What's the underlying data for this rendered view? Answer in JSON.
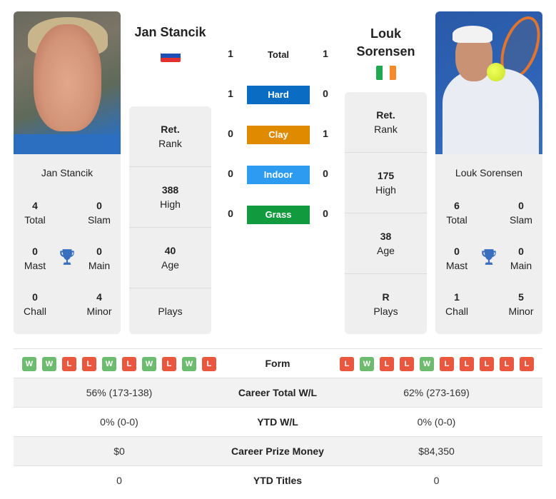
{
  "colors": {
    "hard": "#0a6cc2",
    "clay": "#e08a00",
    "indoor": "#2d9bf0",
    "grass": "#119a3e",
    "win": "#6dbb6f",
    "loss": "#e9573f",
    "trophy": "#3a6fbf"
  },
  "player1": {
    "name": "Jan Stancik",
    "country_flag": "slovakia-flag",
    "card_name": "Jan Stancik",
    "titles": {
      "total": {
        "value": "4",
        "label": "Total"
      },
      "slam": {
        "value": "0",
        "label": "Slam"
      },
      "mast": {
        "value": "0",
        "label": "Mast"
      },
      "main": {
        "value": "0",
        "label": "Main"
      },
      "chall": {
        "value": "0",
        "label": "Chall"
      },
      "minor": {
        "value": "4",
        "label": "Minor"
      }
    },
    "rank": {
      "value": "Ret.",
      "label": "Rank"
    },
    "high": {
      "value": "388",
      "label": "High"
    },
    "age": {
      "value": "40",
      "label": "Age"
    },
    "plays": {
      "value": "",
      "label": "Plays"
    },
    "form": [
      "W",
      "W",
      "L",
      "L",
      "W",
      "L",
      "W",
      "L",
      "W",
      "L"
    ],
    "career_wl": "56% (173-138)",
    "ytd_wl": "0% (0-0)",
    "prize_money": "$0",
    "ytd_titles": "0"
  },
  "player2": {
    "name_line1": "Louk",
    "name_line2": "Sorensen",
    "country_flag": "ireland-flag",
    "card_name": "Louk Sorensen",
    "titles": {
      "total": {
        "value": "6",
        "label": "Total"
      },
      "slam": {
        "value": "0",
        "label": "Slam"
      },
      "mast": {
        "value": "0",
        "label": "Mast"
      },
      "main": {
        "value": "0",
        "label": "Main"
      },
      "chall": {
        "value": "1",
        "label": "Chall"
      },
      "minor": {
        "value": "5",
        "label": "Minor"
      }
    },
    "rank": {
      "value": "Ret.",
      "label": "Rank"
    },
    "high": {
      "value": "175",
      "label": "High"
    },
    "age": {
      "value": "38",
      "label": "Age"
    },
    "plays": {
      "value": "R",
      "label": "Plays"
    },
    "form": [
      "L",
      "W",
      "L",
      "L",
      "W",
      "L",
      "L",
      "L",
      "L",
      "L"
    ],
    "career_wl": "62% (273-169)",
    "ytd_wl": "0% (0-0)",
    "prize_money": "$84,350",
    "ytd_titles": "0"
  },
  "h2h": [
    {
      "label": "Total",
      "p1": "1",
      "p2": "1"
    },
    {
      "label": "Hard",
      "p1": "1",
      "p2": "0"
    },
    {
      "label": "Clay",
      "p1": "0",
      "p2": "1"
    },
    {
      "label": "Indoor",
      "p1": "0",
      "p2": "0"
    },
    {
      "label": "Grass",
      "p1": "0",
      "p2": "0"
    }
  ],
  "table_labels": {
    "form": "Form",
    "career_wl": "Career Total W/L",
    "ytd_wl": "YTD W/L",
    "prize_money": "Career Prize Money",
    "ytd_titles": "YTD Titles"
  }
}
